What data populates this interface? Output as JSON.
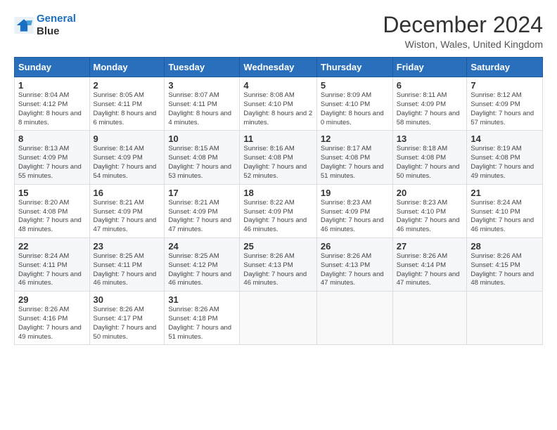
{
  "logo": {
    "line1": "General",
    "line2": "Blue"
  },
  "header": {
    "month": "December 2024",
    "location": "Wiston, Wales, United Kingdom"
  },
  "days_of_week": [
    "Sunday",
    "Monday",
    "Tuesday",
    "Wednesday",
    "Thursday",
    "Friday",
    "Saturday"
  ],
  "weeks": [
    [
      {
        "day": "1",
        "sunrise": "Sunrise: 8:04 AM",
        "sunset": "Sunset: 4:12 PM",
        "daylight": "Daylight: 8 hours and 8 minutes."
      },
      {
        "day": "2",
        "sunrise": "Sunrise: 8:05 AM",
        "sunset": "Sunset: 4:11 PM",
        "daylight": "Daylight: 8 hours and 6 minutes."
      },
      {
        "day": "3",
        "sunrise": "Sunrise: 8:07 AM",
        "sunset": "Sunset: 4:11 PM",
        "daylight": "Daylight: 8 hours and 4 minutes."
      },
      {
        "day": "4",
        "sunrise": "Sunrise: 8:08 AM",
        "sunset": "Sunset: 4:10 PM",
        "daylight": "Daylight: 8 hours and 2 minutes."
      },
      {
        "day": "5",
        "sunrise": "Sunrise: 8:09 AM",
        "sunset": "Sunset: 4:10 PM",
        "daylight": "Daylight: 8 hours and 0 minutes."
      },
      {
        "day": "6",
        "sunrise": "Sunrise: 8:11 AM",
        "sunset": "Sunset: 4:09 PM",
        "daylight": "Daylight: 7 hours and 58 minutes."
      },
      {
        "day": "7",
        "sunrise": "Sunrise: 8:12 AM",
        "sunset": "Sunset: 4:09 PM",
        "daylight": "Daylight: 7 hours and 57 minutes."
      }
    ],
    [
      {
        "day": "8",
        "sunrise": "Sunrise: 8:13 AM",
        "sunset": "Sunset: 4:09 PM",
        "daylight": "Daylight: 7 hours and 55 minutes."
      },
      {
        "day": "9",
        "sunrise": "Sunrise: 8:14 AM",
        "sunset": "Sunset: 4:09 PM",
        "daylight": "Daylight: 7 hours and 54 minutes."
      },
      {
        "day": "10",
        "sunrise": "Sunrise: 8:15 AM",
        "sunset": "Sunset: 4:08 PM",
        "daylight": "Daylight: 7 hours and 53 minutes."
      },
      {
        "day": "11",
        "sunrise": "Sunrise: 8:16 AM",
        "sunset": "Sunset: 4:08 PM",
        "daylight": "Daylight: 7 hours and 52 minutes."
      },
      {
        "day": "12",
        "sunrise": "Sunrise: 8:17 AM",
        "sunset": "Sunset: 4:08 PM",
        "daylight": "Daylight: 7 hours and 51 minutes."
      },
      {
        "day": "13",
        "sunrise": "Sunrise: 8:18 AM",
        "sunset": "Sunset: 4:08 PM",
        "daylight": "Daylight: 7 hours and 50 minutes."
      },
      {
        "day": "14",
        "sunrise": "Sunrise: 8:19 AM",
        "sunset": "Sunset: 4:08 PM",
        "daylight": "Daylight: 7 hours and 49 minutes."
      }
    ],
    [
      {
        "day": "15",
        "sunrise": "Sunrise: 8:20 AM",
        "sunset": "Sunset: 4:08 PM",
        "daylight": "Daylight: 7 hours and 48 minutes."
      },
      {
        "day": "16",
        "sunrise": "Sunrise: 8:21 AM",
        "sunset": "Sunset: 4:09 PM",
        "daylight": "Daylight: 7 hours and 47 minutes."
      },
      {
        "day": "17",
        "sunrise": "Sunrise: 8:21 AM",
        "sunset": "Sunset: 4:09 PM",
        "daylight": "Daylight: 7 hours and 47 minutes."
      },
      {
        "day": "18",
        "sunrise": "Sunrise: 8:22 AM",
        "sunset": "Sunset: 4:09 PM",
        "daylight": "Daylight: 7 hours and 46 minutes."
      },
      {
        "day": "19",
        "sunrise": "Sunrise: 8:23 AM",
        "sunset": "Sunset: 4:09 PM",
        "daylight": "Daylight: 7 hours and 46 minutes."
      },
      {
        "day": "20",
        "sunrise": "Sunrise: 8:23 AM",
        "sunset": "Sunset: 4:10 PM",
        "daylight": "Daylight: 7 hours and 46 minutes."
      },
      {
        "day": "21",
        "sunrise": "Sunrise: 8:24 AM",
        "sunset": "Sunset: 4:10 PM",
        "daylight": "Daylight: 7 hours and 46 minutes."
      }
    ],
    [
      {
        "day": "22",
        "sunrise": "Sunrise: 8:24 AM",
        "sunset": "Sunset: 4:11 PM",
        "daylight": "Daylight: 7 hours and 46 minutes."
      },
      {
        "day": "23",
        "sunrise": "Sunrise: 8:25 AM",
        "sunset": "Sunset: 4:11 PM",
        "daylight": "Daylight: 7 hours and 46 minutes."
      },
      {
        "day": "24",
        "sunrise": "Sunrise: 8:25 AM",
        "sunset": "Sunset: 4:12 PM",
        "daylight": "Daylight: 7 hours and 46 minutes."
      },
      {
        "day": "25",
        "sunrise": "Sunrise: 8:26 AM",
        "sunset": "Sunset: 4:13 PM",
        "daylight": "Daylight: 7 hours and 46 minutes."
      },
      {
        "day": "26",
        "sunrise": "Sunrise: 8:26 AM",
        "sunset": "Sunset: 4:13 PM",
        "daylight": "Daylight: 7 hours and 47 minutes."
      },
      {
        "day": "27",
        "sunrise": "Sunrise: 8:26 AM",
        "sunset": "Sunset: 4:14 PM",
        "daylight": "Daylight: 7 hours and 47 minutes."
      },
      {
        "day": "28",
        "sunrise": "Sunrise: 8:26 AM",
        "sunset": "Sunset: 4:15 PM",
        "daylight": "Daylight: 7 hours and 48 minutes."
      }
    ],
    [
      {
        "day": "29",
        "sunrise": "Sunrise: 8:26 AM",
        "sunset": "Sunset: 4:16 PM",
        "daylight": "Daylight: 7 hours and 49 minutes."
      },
      {
        "day": "30",
        "sunrise": "Sunrise: 8:26 AM",
        "sunset": "Sunset: 4:17 PM",
        "daylight": "Daylight: 7 hours and 50 minutes."
      },
      {
        "day": "31",
        "sunrise": "Sunrise: 8:26 AM",
        "sunset": "Sunset: 4:18 PM",
        "daylight": "Daylight: 7 hours and 51 minutes."
      },
      null,
      null,
      null,
      null
    ]
  ]
}
